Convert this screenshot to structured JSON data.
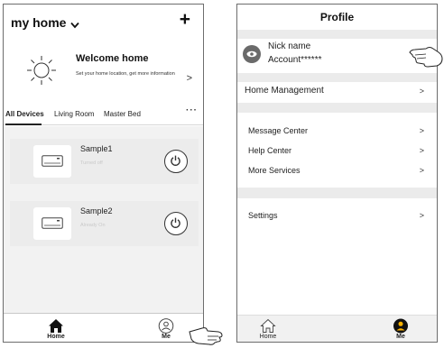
{
  "left": {
    "home_title": "my home",
    "add_label": "+",
    "welcome": {
      "title": "Welcome home",
      "subtitle": "Set your home location, get more information",
      "arrow": ">"
    },
    "tabs": [
      {
        "label": "All Devices",
        "active": true
      },
      {
        "label": "Living Room",
        "active": false
      },
      {
        "label": "Master Bed",
        "active": false
      }
    ],
    "tabs_more": "···",
    "devices": [
      {
        "name": "Sample1",
        "status": "Turned off"
      },
      {
        "name": "Sample2",
        "status": "Already On"
      }
    ],
    "nav": [
      {
        "label": "Home",
        "icon": "home-filled-icon"
      },
      {
        "label": "Me",
        "icon": "person-outline-icon"
      }
    ]
  },
  "right": {
    "title": "Profile",
    "nickname": "Nick name",
    "account": "Account******",
    "rows": {
      "home_management": "Home Management",
      "message_center": "Message Center",
      "help_center": "Help Center",
      "more_services": "More Services",
      "settings": "Settings"
    },
    "arrow": ">",
    "nav": [
      {
        "label": "Home",
        "icon": "home-outline-icon"
      },
      {
        "label": "Me",
        "icon": "person-filled-icon"
      }
    ]
  },
  "colors": {
    "frame": "#6d6d6d",
    "divider_gray": "#ebebeb",
    "device_bg": "#f2f2f2",
    "status_text": "#c9c9c9"
  }
}
